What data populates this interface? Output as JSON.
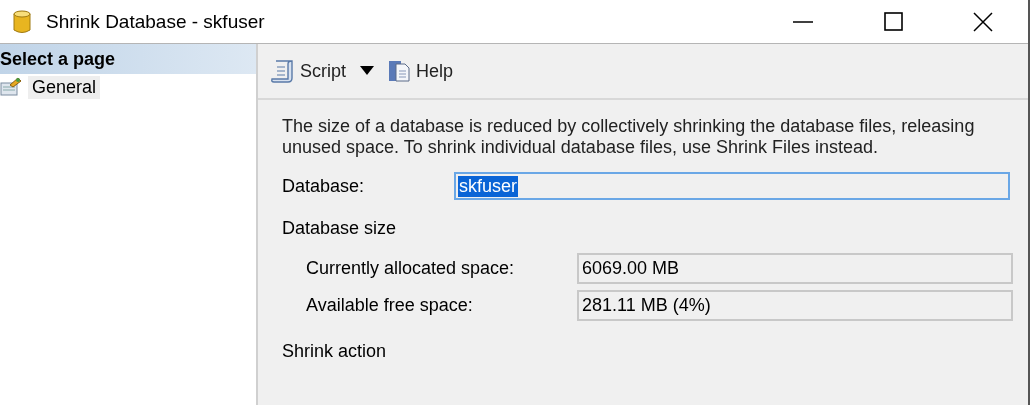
{
  "window": {
    "title": "Shrink Database - skfuser"
  },
  "sidebar": {
    "header": "Select a page",
    "items": [
      {
        "label": "General",
        "selected": true
      }
    ]
  },
  "toolbar": {
    "items": [
      {
        "kind": "script",
        "label": "Script"
      },
      {
        "kind": "help",
        "label": "Help"
      }
    ]
  },
  "description": "The size of a database is reduced by collectively shrinking the database files, releasing unused space. To shrink individual database files, use Shrink Files instead.",
  "database": {
    "label": "Database:",
    "value": "skfuser",
    "text_selected": true
  },
  "database_size": {
    "heading": "Database size",
    "fields": [
      {
        "label": "Currently allocated space:",
        "value": "6069.00 MB"
      },
      {
        "label": "Available free space:",
        "value": "281.11 MB (4%)"
      }
    ]
  },
  "shrink_action": {
    "heading": "Shrink action"
  }
}
